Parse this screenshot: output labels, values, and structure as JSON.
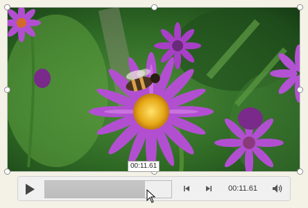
{
  "player": {
    "hover_time": "00:11.61",
    "current_time": "00:11.61",
    "progress_percent": 79
  },
  "icons": {
    "play": "play-icon",
    "previous_frame": "step-back-icon",
    "next_frame": "step-forward-icon",
    "volume": "speaker-icon",
    "cursor": "mouse-pointer-icon"
  },
  "colors": {
    "background": "#f4f1e6",
    "controls_bg": "#f0f0f0",
    "flower": "#b24fd1",
    "flower_center": "#f0c020",
    "foliage": "#3a7a2a"
  }
}
